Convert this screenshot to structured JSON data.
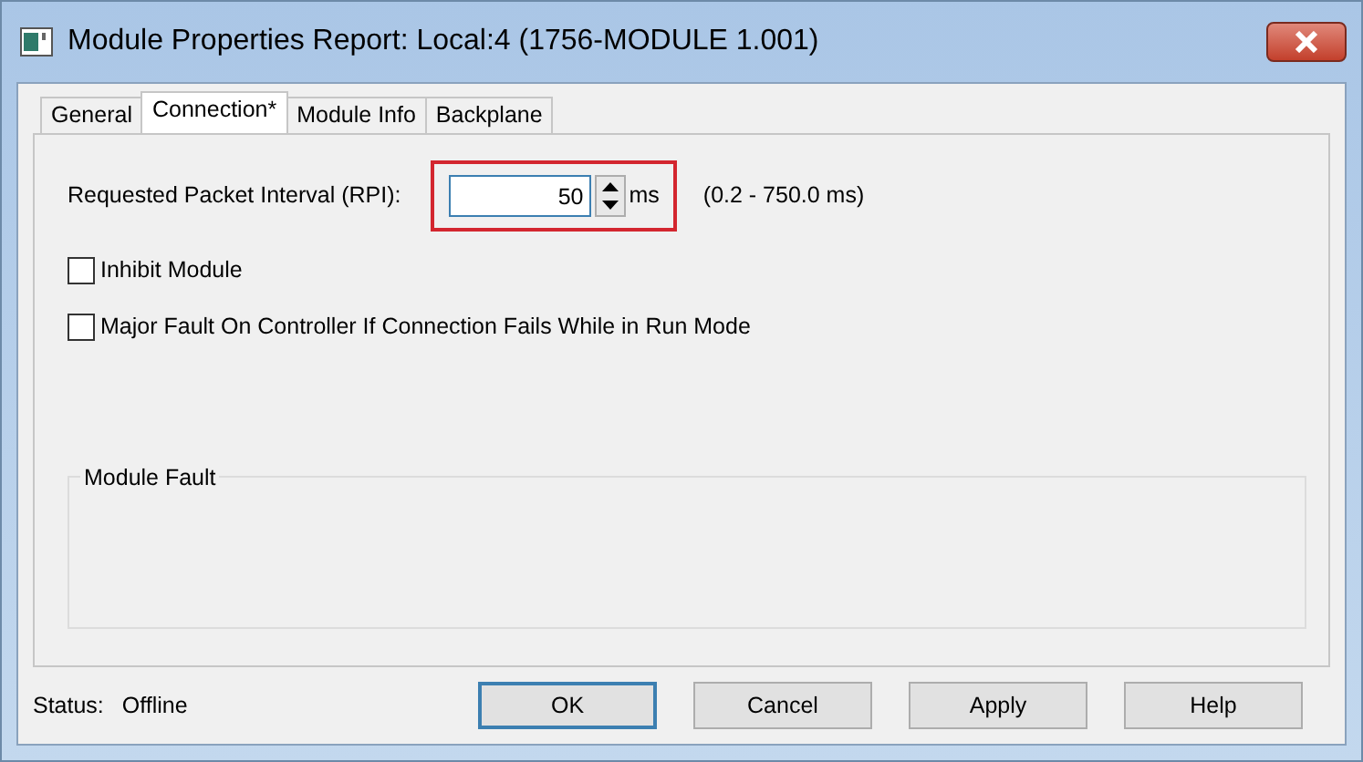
{
  "window": {
    "title": "Module Properties Report: Local:4 (1756-MODULE 1.001)"
  },
  "tabs": [
    {
      "label": "General",
      "selected": false
    },
    {
      "label": "Connection*",
      "selected": true
    },
    {
      "label": "Module Info",
      "selected": false
    },
    {
      "label": "Backplane",
      "selected": false
    }
  ],
  "rpi": {
    "label": "Requested Packet Interval (RPI):",
    "value": "50",
    "unit": "ms",
    "range": "(0.2 - 750.0 ms)"
  },
  "checkboxes": [
    {
      "label": "Inhibit Module",
      "checked": false
    },
    {
      "label": "Major Fault On Controller If Connection Fails While in Run Mode",
      "checked": false
    }
  ],
  "module_fault": {
    "title": "Module Fault"
  },
  "status": {
    "label": "Status:",
    "value": "Offline"
  },
  "buttons": [
    {
      "label": "OK",
      "default": true
    },
    {
      "label": "Cancel",
      "default": false
    },
    {
      "label": "Apply",
      "default": false
    },
    {
      "label": "Help",
      "default": false
    }
  ]
}
